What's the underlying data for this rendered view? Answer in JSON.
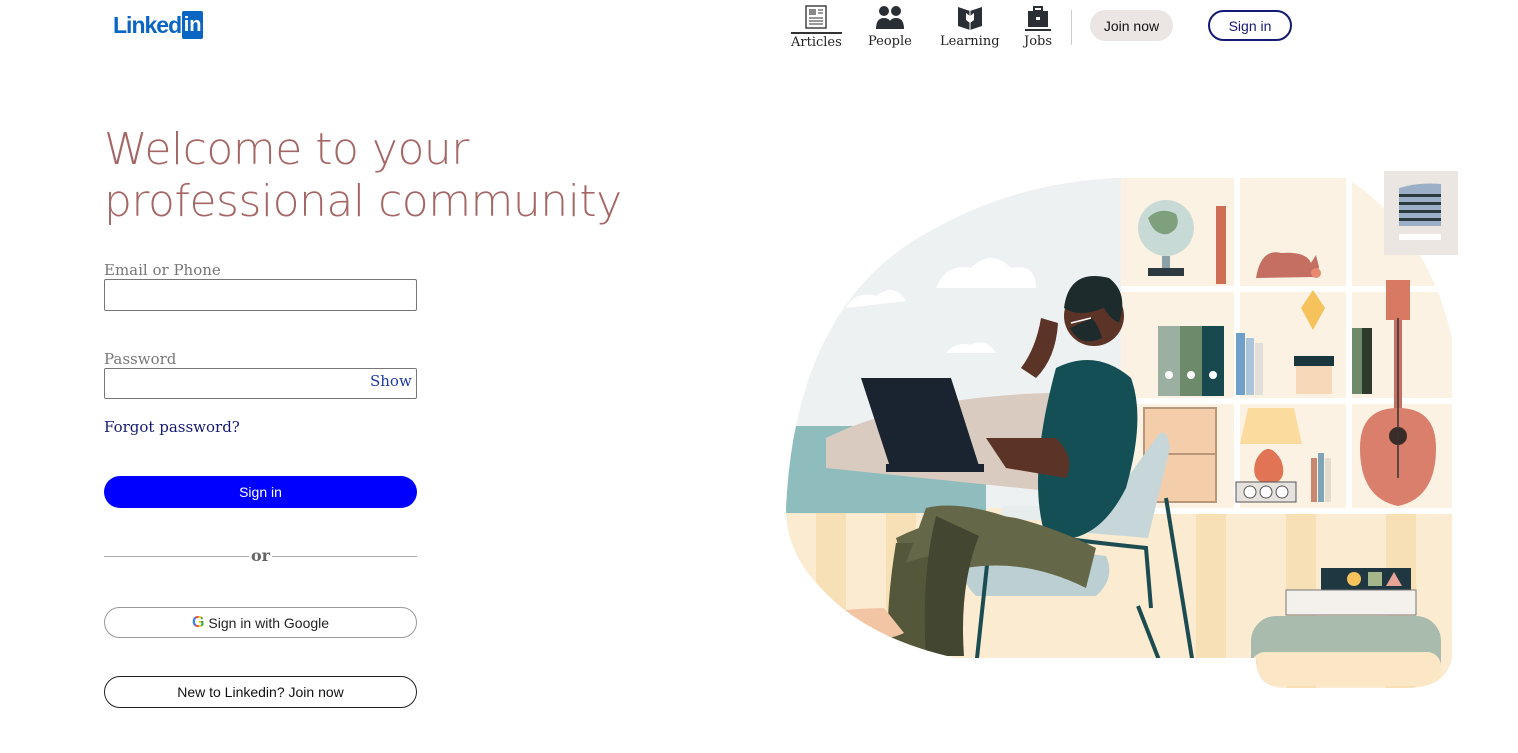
{
  "brand": {
    "name_text": "Linked",
    "name_box": "in"
  },
  "nav": {
    "items": [
      {
        "label": "Articles",
        "icon": "newspaper-icon"
      },
      {
        "label": "People",
        "icon": "people-icon"
      },
      {
        "label": "Learning",
        "icon": "learning-icon"
      },
      {
        "label": "Jobs",
        "icon": "briefcase-icon"
      }
    ],
    "join_label": "Join now",
    "signin_label": "Sign in"
  },
  "main": {
    "headline": "Welcome to your professional community",
    "email_label": "Email or Phone",
    "email_value": "",
    "password_label": "Password",
    "password_value": "",
    "show_label": "Show",
    "forgot_label": "Forgot password?",
    "signin_label": "Sign in",
    "or_label": "or",
    "google_label": "Sign in with Google",
    "join_label": "New to Linkedin? Join now"
  },
  "colors": {
    "brand_blue": "#0a66c2",
    "headline": "#a46765",
    "primary_button": "#0000ff",
    "dark_navy": "#141a73"
  }
}
